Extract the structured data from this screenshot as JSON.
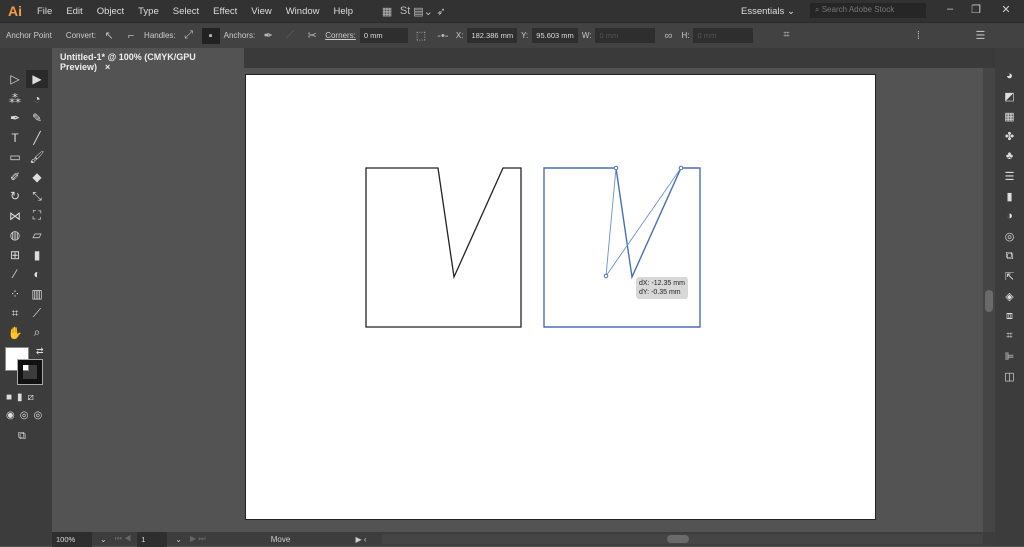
{
  "app": {
    "logo": "Ai"
  },
  "menu": [
    "File",
    "Edit",
    "Object",
    "Type",
    "Select",
    "Effect",
    "View",
    "Window",
    "Help"
  ],
  "workspace": "Essentials",
  "search": {
    "placeholder": "Search Adobe Stock"
  },
  "control": {
    "mode": "Anchor Point",
    "convert": "Convert:",
    "handles": "Handles:",
    "anchors": "Anchors:",
    "corners": "Corners:",
    "corners_value": "0 mm",
    "x_label": "X:",
    "x_value": "182.386 mm",
    "y_label": "Y:",
    "y_value": "95.603 mm",
    "w_label": "W:",
    "w_value": "0 mm",
    "h_label": "H:",
    "h_value": "0 mm"
  },
  "tab": {
    "title": "Untitled-1* @ 100% (CMYK/GPU Preview)",
    "close": "×"
  },
  "tooltip": {
    "dx": "dX: -12.35 mm",
    "dy": "dY: -0.35 mm"
  },
  "status": {
    "zoom": "100%",
    "artboard": "1",
    "tool": "Move"
  },
  "colors": {
    "accent": "#4a6fb5",
    "path": "#222222"
  }
}
